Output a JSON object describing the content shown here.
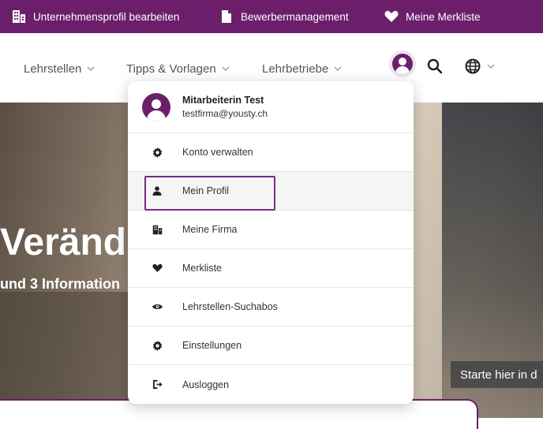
{
  "topbar": {
    "items": [
      {
        "label": "Unternehmensprofil bearbeiten",
        "icon": "building-icon"
      },
      {
        "label": "Bewerbermanagement",
        "icon": "document-icon"
      },
      {
        "label": "Meine Merkliste",
        "icon": "heart-icon"
      }
    ]
  },
  "nav": {
    "items": [
      {
        "label": "Lehrstellen"
      },
      {
        "label": "Tipps & Vorlagen"
      },
      {
        "label": "Lehrbetriebe"
      }
    ]
  },
  "hero": {
    "title": "Veränd",
    "subtitle": "und 3 Information",
    "tooltip": "Starte hier in d"
  },
  "user_menu": {
    "name": "Mitarbeiterin Test",
    "email": "testfirma@yousty.ch",
    "items": [
      {
        "label": "Konto verwalten",
        "icon": "gear-icon"
      },
      {
        "label": "Mein Profil",
        "icon": "person-icon",
        "active": true
      },
      {
        "label": "Meine Firma",
        "icon": "building-icon"
      },
      {
        "label": "Merkliste",
        "icon": "heart-icon"
      },
      {
        "label": "Lehrstellen-Suchabos",
        "icon": "eye-icon"
      },
      {
        "label": "Einstellungen",
        "icon": "gear-icon"
      },
      {
        "label": "Ausloggen",
        "icon": "logout-icon"
      }
    ]
  },
  "colors": {
    "brand": "#6b1f6b",
    "highlight": "#7b2a8a"
  }
}
